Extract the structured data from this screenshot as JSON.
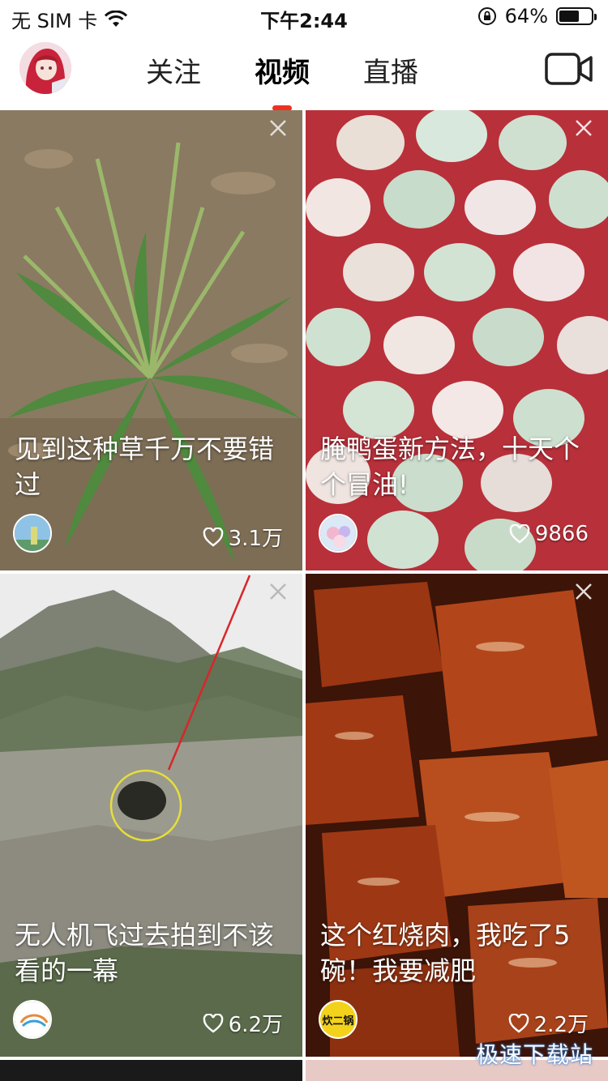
{
  "status_bar": {
    "carrier": "无 SIM 卡",
    "time": "下午2:44",
    "battery_percent": "64%",
    "battery_level": 0.64
  },
  "header": {
    "tabs": [
      {
        "label": "关注",
        "active": false
      },
      {
        "label": "视频",
        "active": true
      },
      {
        "label": "直播",
        "active": false
      }
    ],
    "accent_color": "#f0301f"
  },
  "feed": {
    "cards": [
      {
        "title": "见到这种草千万不要错过",
        "likes": "3.1万"
      },
      {
        "title": "腌鸭蛋新方法，十天个个冒油!",
        "likes": "9866"
      },
      {
        "title": "无人机飞过去拍到不该看的一幕",
        "likes": "6.2万"
      },
      {
        "title": "这个红烧肉，我吃了5碗！我要减肥",
        "likes": "2.2万",
        "author_badge": "炊二锅"
      }
    ]
  },
  "watermark": "极速下载站"
}
